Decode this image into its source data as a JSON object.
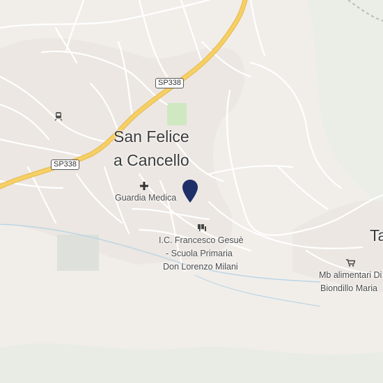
{
  "map": {
    "place_labels": {
      "town_line1": "San Felice",
      "town_line2": "a Cancello",
      "edge_town": "Ta"
    },
    "road_shields": {
      "sp338_top": "SP338",
      "sp338_left": "SP338"
    },
    "pois": {
      "guardia_medica": "Guardia Medica",
      "school_line1": "I.C. Francesco Gesuè",
      "school_line2": "- Scuola Primaria",
      "school_line3": "Don Lorenzo Milani",
      "shop_line1": "Mb alimentari Di",
      "shop_line2": "Biondillo Maria"
    },
    "icons": {
      "selected_marker": "location-pin-icon",
      "guardia_medica": "medical-cross-icon",
      "school": "school-icon",
      "shop": "shopping-cart-icon",
      "train": "train-station-icon"
    },
    "colors": {
      "background": "#f1eeea",
      "major_road": "#f6cf65",
      "marker": "#1f2f68",
      "park": "#cfe8c1",
      "water": "#bcd5e4"
    }
  }
}
